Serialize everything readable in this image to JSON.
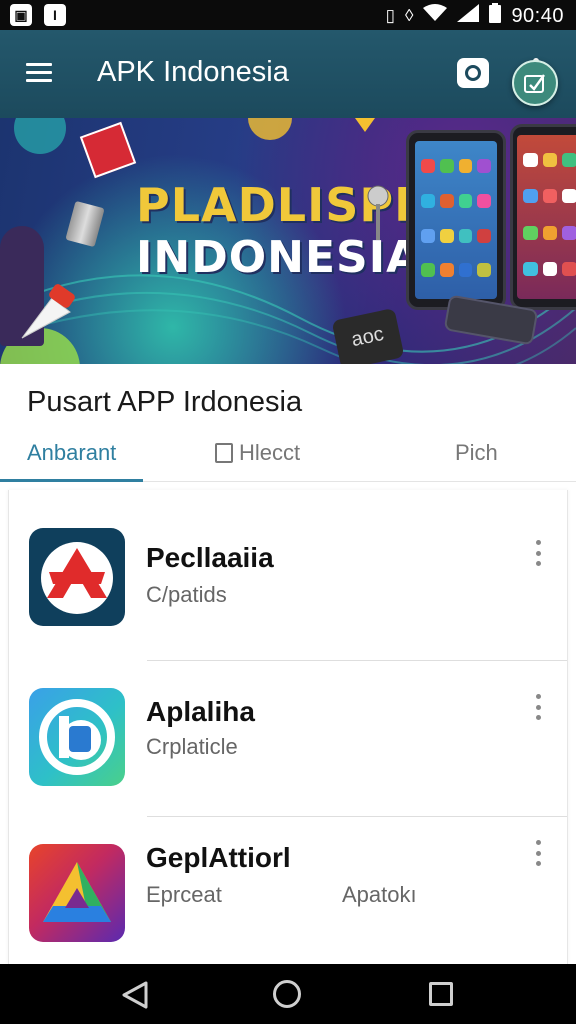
{
  "status_bar": {
    "time": "90:40",
    "left_icons": [
      "gallery-icon",
      "notification-icon"
    ],
    "right_icons": [
      "vibrate-icon",
      "nfc-icon",
      "wifi-icon",
      "signal-icon",
      "battery-icon"
    ],
    "notif_glyph_1": "▣",
    "notif_glyph_2": "I"
  },
  "app_bar": {
    "title": "APK Indonesia",
    "color": "#1f5064"
  },
  "banner": {
    "line1": "PLADLISPR",
    "line2": "INDONESIA",
    "phone_badge": "aoc"
  },
  "section": {
    "title": "Pusart APP Irdonesia"
  },
  "tabs": [
    {
      "label": "Anbarant",
      "active": true
    },
    {
      "label": "Hlecct",
      "active": false
    },
    {
      "label": "Pich",
      "active": false
    }
  ],
  "accent": "#2f7fa0",
  "apps": [
    {
      "name": "Pecllaaiia",
      "subtitle": "C/patids",
      "extra": "",
      "icon": "pecllaaiia-app-icon"
    },
    {
      "name": "Aplaliha",
      "subtitle": "Crplaticle",
      "extra": "",
      "icon": "aplaliha-app-icon"
    },
    {
      "name": "GeplAttiorl",
      "subtitle": "Eprceat",
      "extra": "Apatokı",
      "icon": "geplattiorl-app-icon"
    }
  ]
}
